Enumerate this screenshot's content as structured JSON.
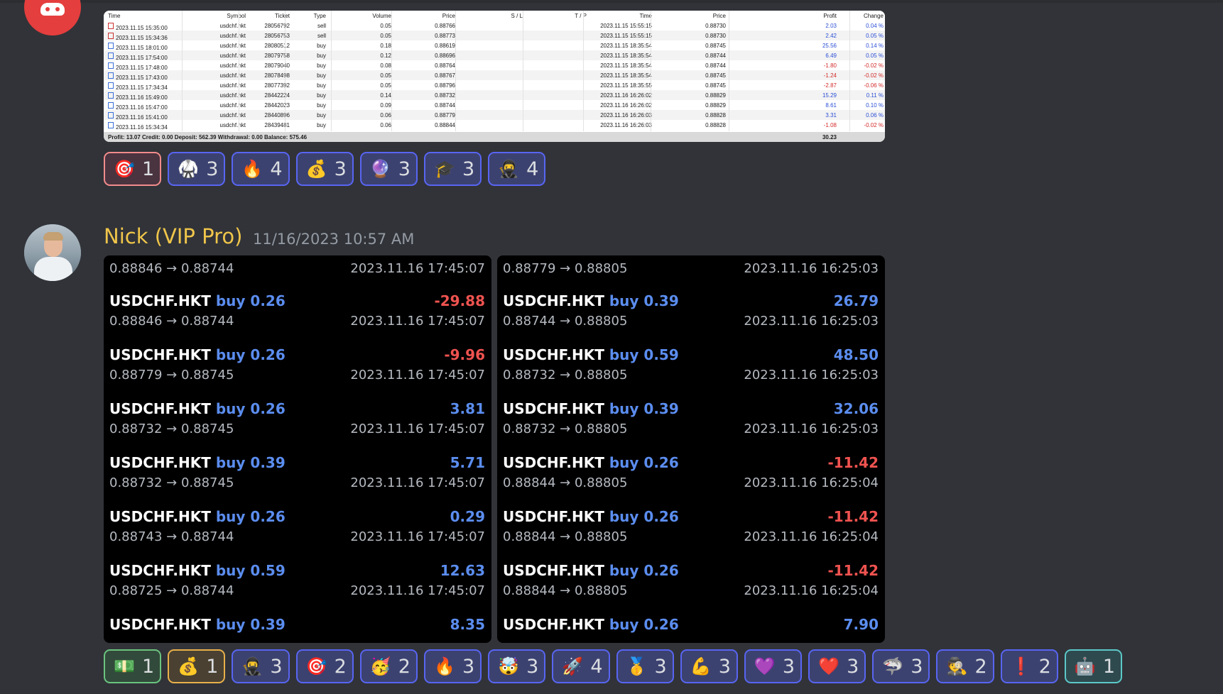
{
  "table": {
    "headers": [
      "Time",
      "Symbol",
      "Ticket",
      "Type",
      "Volume",
      "Price",
      "S / L",
      "T / P",
      "Time",
      "Price",
      "Profit",
      "Change"
    ],
    "rows": [
      {
        "time": "2023.11.15 15:35:00",
        "symbol": "usdchf.hkt",
        "ticket": "28056792",
        "type": "sell",
        "volume": "0.05",
        "price": "0.88766",
        "close_time": "2023.11.15 15:55:15",
        "close_price": "0.88730",
        "profit": "2.03",
        "change": "0.04 %",
        "neg": false
      },
      {
        "time": "2023.11.15 15:34:36",
        "symbol": "usdchf.hkt",
        "ticket": "28056753",
        "type": "sell",
        "volume": "0.05",
        "price": "0.88773",
        "close_time": "2023.11.15 15:55:15",
        "close_price": "0.88730",
        "profit": "2.42",
        "change": "0.05 %",
        "neg": false
      },
      {
        "time": "2023.11.15 18:01:00",
        "symbol": "usdchf.hkt",
        "ticket": "28080512",
        "type": "buy",
        "volume": "0.18",
        "price": "0.88619",
        "close_time": "2023.11.15 18:35:54",
        "close_price": "0.88745",
        "profit": "25.56",
        "change": "0.14 %",
        "neg": false
      },
      {
        "time": "2023.11.15 17:54:00",
        "symbol": "usdchf.hkt",
        "ticket": "28079758",
        "type": "buy",
        "volume": "0.12",
        "price": "0.88696",
        "close_time": "2023.11.15 18:35:54",
        "close_price": "0.88744",
        "profit": "6.49",
        "change": "0.05 %",
        "neg": false
      },
      {
        "time": "2023.11.15 17:48:00",
        "symbol": "usdchf.hkt",
        "ticket": "28079040",
        "type": "buy",
        "volume": "0.08",
        "price": "0.88764",
        "close_time": "2023.11.15 18:35:54",
        "close_price": "0.88744",
        "profit": "-1.80",
        "change": "-0.02 %",
        "neg": true
      },
      {
        "time": "2023.11.15 17:43:00",
        "symbol": "usdchf.hkt",
        "ticket": "28078498",
        "type": "buy",
        "volume": "0.05",
        "price": "0.88767",
        "close_time": "2023.11.15 18:35:54",
        "close_price": "0.88745",
        "profit": "-1.24",
        "change": "-0.02 %",
        "neg": true
      },
      {
        "time": "2023.11.15 17:34:34",
        "symbol": "usdchf.hkt",
        "ticket": "28077392",
        "type": "buy",
        "volume": "0.05",
        "price": "0.88796",
        "close_time": "2023.11.15 18:35:55",
        "close_price": "0.88745",
        "profit": "-2.87",
        "change": "-0.06 %",
        "neg": true
      },
      {
        "time": "2023.11.16 15:49:00",
        "symbol": "usdchf.hkt",
        "ticket": "28442224",
        "type": "buy",
        "volume": "0.14",
        "price": "0.88732",
        "close_time": "2023.11.16 16:26:02",
        "close_price": "0.88829",
        "profit": "15.29",
        "change": "0.11 %",
        "neg": false
      },
      {
        "time": "2023.11.16 15:47:00",
        "symbol": "usdchf.hkt",
        "ticket": "28442023",
        "type": "buy",
        "volume": "0.09",
        "price": "0.88744",
        "close_time": "2023.11.16 16:26:02",
        "close_price": "0.88829",
        "profit": "8.61",
        "change": "0.10 %",
        "neg": false
      },
      {
        "time": "2023.11.16 15:41:00",
        "symbol": "usdchf.hkt",
        "ticket": "28440896",
        "type": "buy",
        "volume": "0.06",
        "price": "0.88779",
        "close_time": "2023.11.16 16:26:03",
        "close_price": "0.88828",
        "profit": "3.31",
        "change": "0.06 %",
        "neg": false
      },
      {
        "time": "2023.11.16 15:34:34",
        "symbol": "usdchf.hkt",
        "ticket": "28439481",
        "type": "buy",
        "volume": "0.06",
        "price": "0.88844",
        "close_time": "2023.11.16 16:26:03",
        "close_price": "0.88828",
        "profit": "-1.08",
        "change": "-0.02 %",
        "neg": true
      }
    ],
    "footer": "Profit: 13.07  Credit: 0.00  Deposit: 562.39  Withdrawal: 0.00  Balance: 575.46",
    "footer_total": "30.23"
  },
  "reactions_top": [
    {
      "emoji": "🎯",
      "count": "1",
      "style": "me-red"
    },
    {
      "emoji": "🥋",
      "count": "3",
      "style": ""
    },
    {
      "emoji": "🔥",
      "count": "4",
      "style": ""
    },
    {
      "emoji": "💰",
      "count": "3",
      "style": ""
    },
    {
      "emoji": "🔮",
      "count": "3",
      "style": ""
    },
    {
      "emoji": "🎓",
      "count": "3",
      "style": ""
    },
    {
      "emoji": "🥷",
      "count": "4",
      "style": ""
    }
  ],
  "message": {
    "username": "Nick (VIP Pro)",
    "timestamp": "11/16/2023 10:57 AM"
  },
  "panel_left": {
    "top": {
      "prices": "0.88846 → 0.88744",
      "when": "2023.11.16 17:45:07"
    },
    "rows": [
      {
        "symbol": "USDCHF.HKT",
        "side": "buy 0.26",
        "pnl": "-29.88",
        "neg": true,
        "prices": "0.88846 → 0.88744",
        "when": "2023.11.16 17:45:07"
      },
      {
        "symbol": "USDCHF.HKT",
        "side": "buy 0.26",
        "pnl": "-9.96",
        "neg": true,
        "prices": "0.88779 → 0.88745",
        "when": "2023.11.16 17:45:07"
      },
      {
        "symbol": "USDCHF.HKT",
        "side": "buy 0.26",
        "pnl": "3.81",
        "neg": false,
        "prices": "0.88732 → 0.88745",
        "when": "2023.11.16 17:45:07"
      },
      {
        "symbol": "USDCHF.HKT",
        "side": "buy 0.39",
        "pnl": "5.71",
        "neg": false,
        "prices": "0.88732 → 0.88745",
        "when": "2023.11.16 17:45:07"
      },
      {
        "symbol": "USDCHF.HKT",
        "side": "buy 0.26",
        "pnl": "0.29",
        "neg": false,
        "prices": "0.88743 → 0.88744",
        "when": "2023.11.16 17:45:07"
      },
      {
        "symbol": "USDCHF.HKT",
        "side": "buy 0.59",
        "pnl": "12.63",
        "neg": false,
        "prices": "0.88725 → 0.88744",
        "when": "2023.11.16 17:45:07"
      },
      {
        "symbol": "USDCHF.HKT",
        "side": "buy 0.39",
        "pnl": "8.35",
        "neg": false,
        "prices": "",
        "when": ""
      }
    ]
  },
  "panel_right": {
    "top": {
      "prices": "0.88779 → 0.88805",
      "when": "2023.11.16 16:25:03"
    },
    "rows": [
      {
        "symbol": "USDCHF.HKT",
        "side": "buy 0.39",
        "pnl": "26.79",
        "neg": false,
        "prices": "0.88744 → 0.88805",
        "when": "2023.11.16 16:25:03"
      },
      {
        "symbol": "USDCHF.HKT",
        "side": "buy 0.59",
        "pnl": "48.50",
        "neg": false,
        "prices": "0.88732 → 0.88805",
        "when": "2023.11.16 16:25:03"
      },
      {
        "symbol": "USDCHF.HKT",
        "side": "buy 0.39",
        "pnl": "32.06",
        "neg": false,
        "prices": "0.88732 → 0.88805",
        "when": "2023.11.16 16:25:03"
      },
      {
        "symbol": "USDCHF.HKT",
        "side": "buy 0.26",
        "pnl": "-11.42",
        "neg": true,
        "prices": "0.88844 → 0.88805",
        "when": "2023.11.16 16:25:04"
      },
      {
        "symbol": "USDCHF.HKT",
        "side": "buy 0.26",
        "pnl": "-11.42",
        "neg": true,
        "prices": "0.88844 → 0.88805",
        "when": "2023.11.16 16:25:04"
      },
      {
        "symbol": "USDCHF.HKT",
        "side": "buy 0.26",
        "pnl": "-11.42",
        "neg": true,
        "prices": "0.88844 → 0.88805",
        "when": "2023.11.16 16:25:04"
      },
      {
        "symbol": "USDCHF.HKT",
        "side": "buy 0.26",
        "pnl": "7.90",
        "neg": false,
        "prices": "",
        "when": ""
      }
    ]
  },
  "reactions_bottom": [
    {
      "emoji": "💵",
      "count": "1",
      "style": "me-green"
    },
    {
      "emoji": "💰",
      "count": "1",
      "style": "me-gold"
    },
    {
      "emoji": "🥷",
      "count": "3",
      "style": ""
    },
    {
      "emoji": "🎯",
      "count": "2",
      "style": ""
    },
    {
      "emoji": "🥳",
      "count": "2",
      "style": ""
    },
    {
      "emoji": "🔥",
      "count": "3",
      "style": ""
    },
    {
      "emoji": "🤯",
      "count": "3",
      "style": ""
    },
    {
      "emoji": "🚀",
      "count": "4",
      "style": ""
    },
    {
      "emoji": "🥇",
      "count": "3",
      "style": ""
    },
    {
      "emoji": "💪",
      "count": "3",
      "style": ""
    },
    {
      "emoji": "💜",
      "count": "3",
      "style": ""
    },
    {
      "emoji": "❤️",
      "count": "3",
      "style": ""
    },
    {
      "emoji": "🦈",
      "count": "3",
      "style": ""
    },
    {
      "emoji": "🕵️",
      "count": "2",
      "style": ""
    },
    {
      "emoji": "❗",
      "count": "2",
      "style": ""
    },
    {
      "emoji": "🤖",
      "count": "1",
      "style": "me-teal"
    }
  ]
}
